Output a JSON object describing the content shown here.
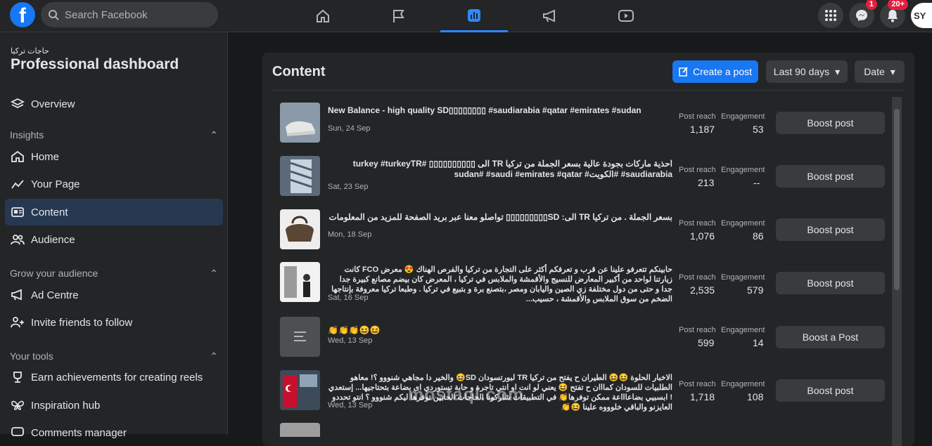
{
  "search": {
    "placeholder": "Search Facebook"
  },
  "badges": {
    "messenger": "1",
    "notifications": "20+"
  },
  "avatar_initials": "SY",
  "sidebar": {
    "page_name": "حاجات تركيا",
    "title": "Professional dashboard",
    "overview": "Overview",
    "insights_header": "Insights",
    "home": "Home",
    "your_page": "Your Page",
    "content": "Content",
    "audience": "Audience",
    "grow_header": "Grow your audience",
    "ad_centre": "Ad Centre",
    "invite": "Invite friends to follow",
    "tools_header": "Your tools",
    "earn": "Earn achievements for creating reels",
    "inspiration": "Inspiration hub",
    "comments": "Comments manager"
  },
  "main": {
    "title": "Content",
    "create_post": "Create a post",
    "range": "Last 90 days",
    "sort": "Date",
    "reach_label": "Post reach",
    "engagement_label": "Engagement"
  },
  "posts": [
    {
      "text": "New Balance - high quality SD▯▯▯▯▯▯▯▯ #saudiarabia #qatar #emirates #sudan",
      "date": "Sun, 24 Sep",
      "reach": "1,187",
      "engagement": "53",
      "action": "Boost post"
    },
    {
      "text": "احذية ماركات بجودة عالية بسعر الجملة من تركيا TR الى ▯▯▯▯▯▯▯▯▯▯ #turkey #turkeyTR #saudiarabia #الكويت# sudan# #saudi #emirates #qatar",
      "date": "Sat, 23 Sep",
      "reach": "213",
      "engagement": "--",
      "action": "Boost post"
    },
    {
      "text": "بسعر الجملة . من تركيا TR الى: SD▯▯▯▯▯▯▯▯▯ تواصلو معنا عبر بريد الصفحة للمزيد من المعلومات",
      "date": "Mon, 18 Sep",
      "reach": "1,076",
      "engagement": "86",
      "action": "Boost post"
    },
    {
      "text": "حابينكم تتعرفو علينا عن قرب و تعرفكم أكثر على التجارة من تركيا والفرص الهناك 😍 معرض FCO كانت زيارتنا لواحد من أكبير المعارض للنسيج والأقمشة والملابس في تركيا ، المعرض كان بيضم مصانع كبيرة جدا جدا و حتى من دول مختلفة زي الصين واليابان ومصر ،بتصنع برة و بتبيع في تركيا . وطبعا تركيا معروفة بإنتاجها الضخم من سوق الملابس والأقمشة ، حسيب...",
      "date": "Sat, 16 Sep",
      "reach": "2,535",
      "engagement": "579",
      "action": "Boost post"
    },
    {
      "text": "👏👏👏😆😆",
      "date": "Wed, 13 Sep",
      "reach": "599",
      "engagement": "14",
      "action": "Boost a Post"
    },
    {
      "text": "الاخبار الحلوة 😆😆 الطيران ح يفتح من تركيا TR لبورتسودان SD😆 والخير دا مجاهي شنووو ؟! معاهو الطلبيات للسودان كمااان ح تفتح 😆 يعني لو انت او انتي تاجرة و حابة تستوردي اى بضاعة بتحتاجيها... إستعدي ! ابسبيي بضاعاااعة ممكن توفرها👏 في التطبيقات شاركونا الحاجات الحابين توفرها ليكم شنووو ؟ انتو تحددو العايزنو والباقي خلوووه علينا 😆👏",
      "date": "Wed, 13 Sep",
      "reach": "1,718",
      "engagement": "108",
      "action": "Boost post"
    }
  ],
  "watermark": "mostaql.com"
}
